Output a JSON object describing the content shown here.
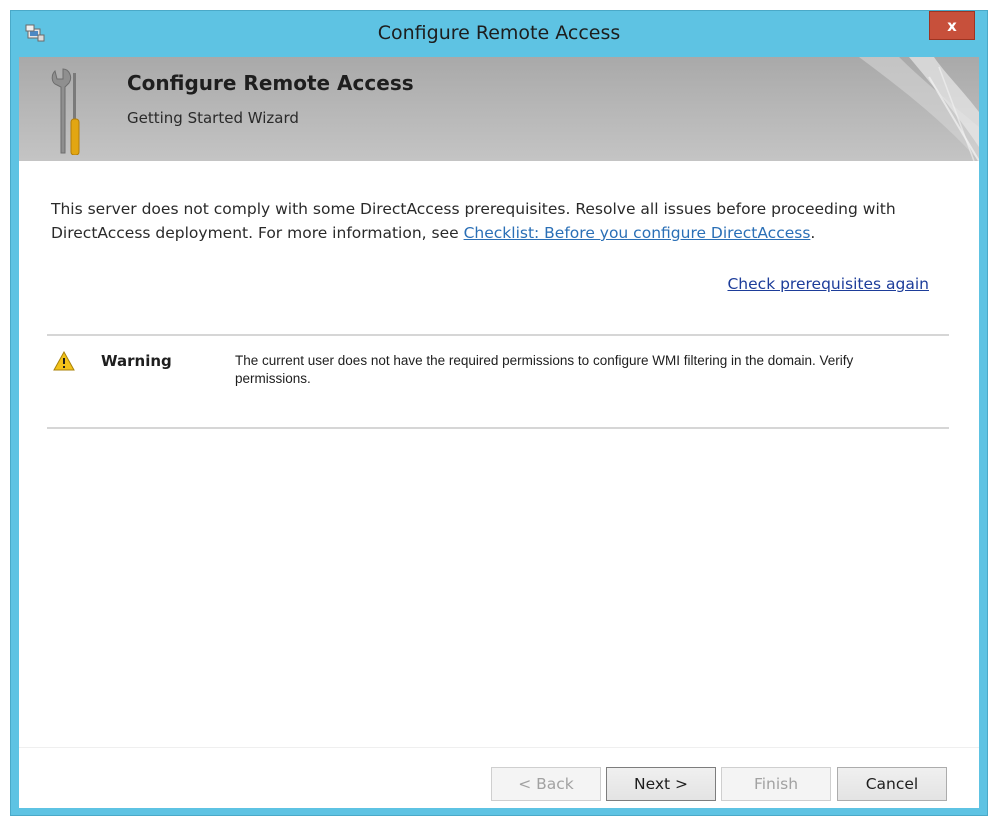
{
  "window": {
    "title": "Configure Remote Access",
    "close_label": "x"
  },
  "banner": {
    "title": "Configure Remote Access",
    "subtitle": "Getting Started Wizard"
  },
  "intro": {
    "text": "This server does not comply with some DirectAccess prerequisites. Resolve all issues before proceeding with DirectAccess deployment. For more information, see ",
    "link": "Checklist: Before you configure DirectAccess",
    "after_link": "."
  },
  "recheck_link": "Check prerequisites again",
  "issue": {
    "icon": "warning-icon",
    "label": "Warning",
    "message": "The current user does not have the required permissions to configure WMI filtering in the domain. Verify permissions."
  },
  "buttons": {
    "back": "< Back",
    "next": "Next >",
    "finish": "Finish",
    "cancel": "Cancel"
  },
  "colors": {
    "titlebar": "#5ec3e3",
    "close": "#c7503b",
    "link": "#2a6fb6",
    "warning": "#f2c21a"
  }
}
